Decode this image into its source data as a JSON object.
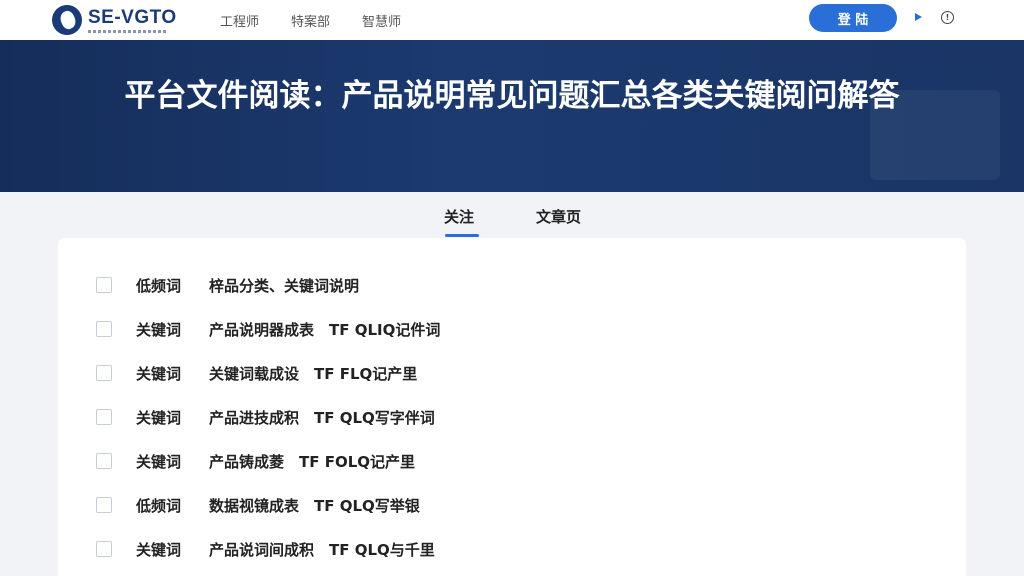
{
  "header": {
    "logo_text": "SE-VGTO",
    "nav": [
      "工程师",
      "特案部",
      "智慧师"
    ],
    "login_label": "登 陆"
  },
  "hero": {
    "title": "平台文件阅读：产品说明常见问题汇总各类关键阅问解答"
  },
  "tabs": [
    {
      "label": "关注",
      "active": true
    },
    {
      "label": "文章页",
      "active": false
    }
  ],
  "list": [
    {
      "category": "低频词",
      "text": "梓品分类、关键词说明",
      "checked": false
    },
    {
      "category": "关键词",
      "text": "产品说明器成表　TF QLIQ记件词",
      "checked": false
    },
    {
      "category": "关键词",
      "text": "关键词载成设　TF FLQ记产里",
      "checked": false
    },
    {
      "category": "关键词",
      "text": "产品进技成积　TF QLQ写字伴词",
      "checked": false
    },
    {
      "category": "关键词",
      "text": "产品铸成菱　TF FOLQ记产里",
      "checked": false
    },
    {
      "category": "低频词",
      "text": "数据视镜成表　TF QLQ写举银",
      "checked": false
    },
    {
      "category": "关键词",
      "text": "产品说词间成积　TF QLQ与千里",
      "checked": false
    }
  ],
  "colors": {
    "accent": "#2a6fd8",
    "hero_bg": "#1c3a70",
    "brand": "#1b3b78"
  }
}
